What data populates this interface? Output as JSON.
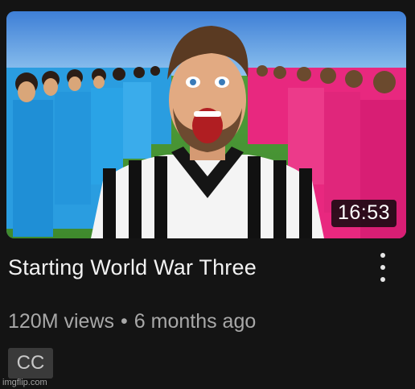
{
  "video": {
    "duration": "16:53",
    "title": "Starting World War Three",
    "views": "120M views",
    "separator": "•",
    "age": "6 months ago",
    "badge": "CC"
  },
  "icons": {
    "more": "more-vertical-icon"
  },
  "watermark": "imgflip.com",
  "colors": {
    "background": "#141414",
    "title": "#f2f2f2",
    "meta": "#a8a8a8",
    "badge_bg": "#3a3a3a",
    "team_left": "#2aa3e6",
    "team_right": "#e8287f"
  }
}
